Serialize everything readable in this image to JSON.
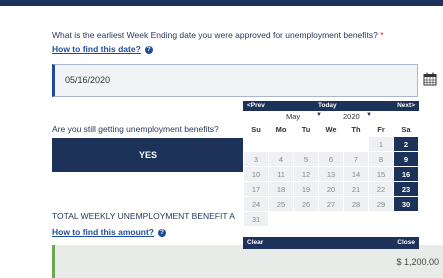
{
  "form": {
    "question_week_ending": "What is the earliest Week Ending date you were approved for unemployment benefits?",
    "required_marker": "*",
    "how_to_find_date": "How to find this date?",
    "help_icon_glyph": "?",
    "date_value": "05/16/2020",
    "question_still_getting": "Are you still getting unemployment benefits?",
    "yes_label": "YES",
    "total_weekly_label": "TOTAL WEEKLY UNEMPLOYMENT BENEFIT A",
    "how_to_find_amount": "How to find this amount?",
    "amount_value": "$ 1,200.00"
  },
  "datepicker": {
    "prev": "<Prev",
    "today": "Today",
    "next": "Next>",
    "month": "May",
    "year": "2020",
    "weekdays": [
      "Su",
      "Mo",
      "Tu",
      "We",
      "Th",
      "Fr",
      "Sa"
    ],
    "weeks": [
      [
        "",
        "",
        "",
        "",
        "",
        "1",
        "2"
      ],
      [
        "3",
        "4",
        "5",
        "6",
        "7",
        "8",
        "9"
      ],
      [
        "10",
        "11",
        "12",
        "13",
        "14",
        "15",
        "16"
      ],
      [
        "17",
        "18",
        "19",
        "20",
        "21",
        "22",
        "23"
      ],
      [
        "24",
        "25",
        "26",
        "27",
        "28",
        "29",
        "30"
      ],
      [
        "31",
        "",
        "",
        "",
        "",
        "",
        ""
      ]
    ],
    "clear": "Clear",
    "close": "Close"
  },
  "colors": {
    "navy": "#1c3259",
    "link_blue": "#1f4e98",
    "required_red": "#dd2222",
    "amount_border_green": "#6aa84f"
  }
}
